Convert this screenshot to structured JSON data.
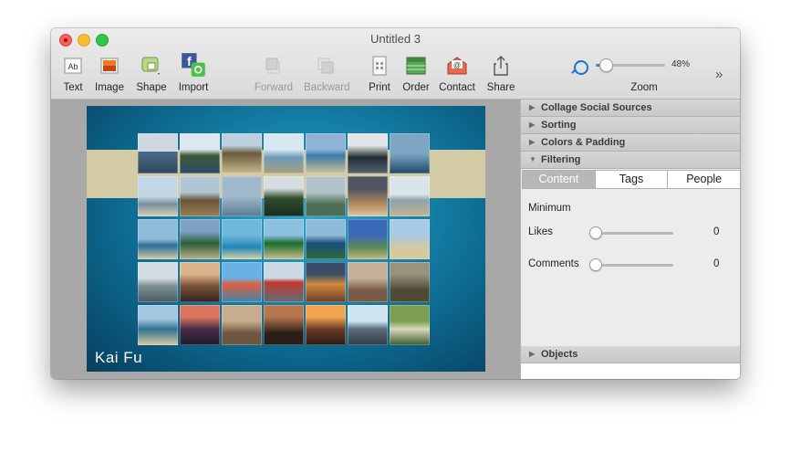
{
  "window": {
    "title": "Untitled 3"
  },
  "toolbar": {
    "text": "Text",
    "image": "Image",
    "shape": "Shape",
    "import": "Import",
    "forward": "Forward",
    "backward": "Backward",
    "print": "Print",
    "order": "Order",
    "contact": "Contact",
    "share": "Share",
    "zoom_label": "Zoom",
    "zoom_value": "48%",
    "zoom_fraction": 0.15,
    "overflow": "»"
  },
  "canvas": {
    "collage_name": "Kai Fu",
    "background_color": "#0e6f96",
    "band_color": "#d2cba5",
    "photo_rows": 5,
    "photo_cols": 7
  },
  "inspector": {
    "sections": [
      "Collage Social Sources",
      "Sorting",
      "Colors & Padding",
      "Filtering",
      "Objects"
    ],
    "filtering_tabs": [
      "Content",
      "Tags",
      "People"
    ],
    "active_tab": "Content",
    "minimum_label": "Minimum",
    "likes_label": "Likes",
    "likes_value": "0",
    "comments_label": "Comments",
    "comments_value": "0"
  }
}
